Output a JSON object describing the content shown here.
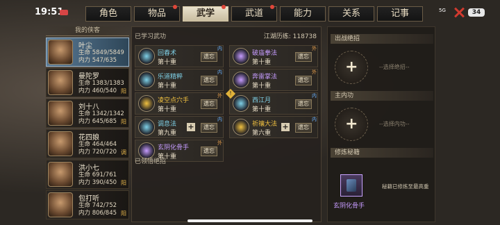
{
  "status": {
    "time": "19:51",
    "signal": "5G",
    "battery": "34"
  },
  "tabs": [
    {
      "label": "角色",
      "dot": false,
      "active": false
    },
    {
      "label": "物品",
      "dot": true,
      "active": false
    },
    {
      "label": "武学",
      "dot": true,
      "active": true
    },
    {
      "label": "武道",
      "dot": true,
      "active": false
    },
    {
      "label": "能力",
      "dot": false,
      "active": false
    },
    {
      "label": "关系",
      "dot": false,
      "active": false
    },
    {
      "label": "记事",
      "dot": false,
      "active": false
    }
  ],
  "heroes_title": "我的侠客",
  "heroes": [
    {
      "name": "叶尘",
      "hp": "生命 5849/5849",
      "mp": "内力 547/635",
      "tag": "",
      "selected": true
    },
    {
      "name": "曼陀罗",
      "hp": "生命 1383/1383",
      "mp": "内力 460/540",
      "tag": "阳",
      "selected": false
    },
    {
      "name": "刘十八",
      "hp": "生命 1342/1342",
      "mp": "内力 645/685",
      "tag": "阳",
      "selected": false
    },
    {
      "name": "花四娘",
      "hp": "生命 464/464",
      "mp": "内力 720/720",
      "tag": "调",
      "selected": false
    },
    {
      "name": "洪小七",
      "hp": "生命 691/761",
      "mp": "内力 390/450",
      "tag": "阳",
      "selected": false
    },
    {
      "name": "包打听",
      "hp": "生命 742/752",
      "mp": "内力 806/845",
      "tag": "阳",
      "selected": false
    }
  ],
  "learned": {
    "title": "已学习武功",
    "exp": "江湖历练: 118738",
    "forget": "遗忘",
    "skills": [
      {
        "name": "回春术",
        "level": "第十重",
        "corner": "内",
        "color": "#7fd1e8",
        "plus": false,
        "warn": false
      },
      {
        "name": "破庙拳法",
        "level": "第十重",
        "corner": "外",
        "color": "#c69cff",
        "plus": false,
        "warn": false
      },
      {
        "name": "乐道精粹",
        "level": "第十重",
        "corner": "内",
        "color": "#7fd1e8",
        "plus": false,
        "warn": false
      },
      {
        "name": "奔雷掌法",
        "level": "第十重",
        "corner": "外",
        "color": "#c69cff",
        "plus": false,
        "warn": false
      },
      {
        "name": "凌空点穴手",
        "level": "第十重",
        "corner": "外",
        "color": "#f0c040",
        "plus": false,
        "warn": false
      },
      {
        "name": "西江月",
        "level": "第十重",
        "corner": "内",
        "color": "#7fd1e8",
        "plus": false,
        "warn": true
      },
      {
        "name": "调息法",
        "level": "第九重",
        "corner": "内",
        "color": "#7fd1e8",
        "plus": true,
        "warn": false
      },
      {
        "name": "祈禳大法",
        "level": "第六重",
        "corner": "内",
        "color": "#f0c040",
        "plus": true,
        "warn": false
      },
      {
        "name": "玄阴化骨手",
        "level": "第十重",
        "corner": "外",
        "color": "#c69cff",
        "plus": false,
        "warn": false
      }
    ]
  },
  "comprehended_title": "已领悟绝招",
  "right": {
    "ult_title": "出战绝招",
    "ult_text": "选择绝招",
    "inner_title": "主内功",
    "inner_text": "选择内功",
    "manual_title": "修炼秘籍",
    "book_name": "玄阴化骨手",
    "book_note": "秘籍已修炼至最高重"
  }
}
